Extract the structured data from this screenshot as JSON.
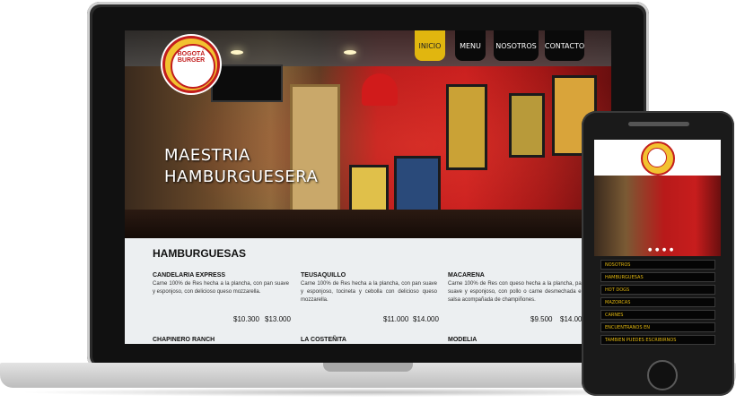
{
  "nav": {
    "inicio": "INICIO",
    "menu": "MENU",
    "nosotros": "NOSOTROS",
    "contacto": "CONTACTO"
  },
  "logo_text": "BOGOTÁ BURGER",
  "hero": {
    "title_line1": "MAESTRIA",
    "title_line2": "HAMBURGUESERA"
  },
  "section_title": "HAMBURGUESAS",
  "items": [
    {
      "name": "CANDELARIA EXPRESS",
      "desc": "Carne 100% de Res hecha a la plancha, con pan suave y esponjoso, con delicioso queso mozzarella.",
      "price1": "$10.300",
      "price2": "$13.000"
    },
    {
      "name": "TEUSAQUILLO",
      "desc": "Carne 100% de Res hecha a la plancha, con pan suave y esponjoso, tocineta y cebolla con delicioso queso mozzarella.",
      "price1": "$11.000",
      "price2": "$14.000"
    },
    {
      "name": "MACARENA",
      "desc": "Carne 100% de Res con queso hecha a la plancha, pan suave y esponjoso, con pollo o carne desmechada en salsa acompañada de champiñones.",
      "price1": "$9.500",
      "price2": "$14.000"
    },
    {
      "name": "CHAPINERO RANCH"
    },
    {
      "name": "LA COSTEÑITA"
    },
    {
      "name": "MODELIA"
    }
  ],
  "phone_menu": [
    "NOSOTROS",
    "HAMBURGUESAS",
    "HOT DOGS",
    "MAZORCAS",
    "CARNES",
    "ENCUENTRANOS EN",
    "TAMBIEN PUEDES ESCRIBIRNOS"
  ],
  "colors": {
    "accent": "#e1b60f",
    "brand_red": "#c21d1d"
  }
}
